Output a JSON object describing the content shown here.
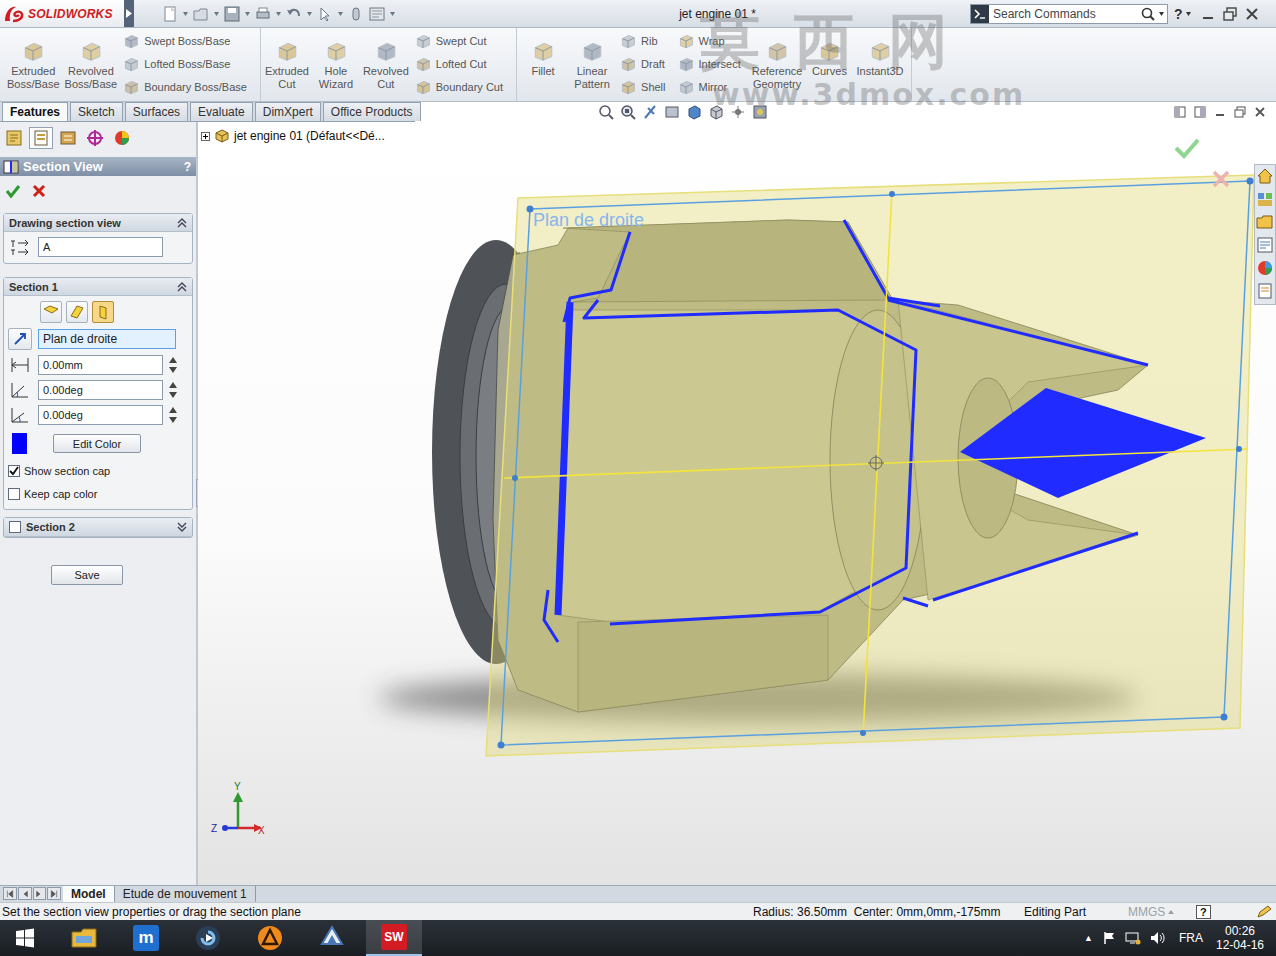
{
  "window": {
    "app": "SOLIDWORKS",
    "title": "jet engine 01 *",
    "search": {
      "placeholder": "Search Commands"
    },
    "help": "?"
  },
  "ribbon": {
    "groups": [
      {
        "items": [
          {
            "kind": "big",
            "label": "Extruded Boss/Base"
          },
          {
            "kind": "big",
            "label": "Revolved Boss/Base"
          },
          {
            "kind": "stack",
            "rows": [
              {
                "label": "Swept Boss/Base"
              },
              {
                "label": "Lofted Boss/Base"
              },
              {
                "label": "Boundary Boss/Base"
              }
            ]
          }
        ]
      },
      {
        "items": [
          {
            "kind": "big",
            "label": "Extruded Cut"
          },
          {
            "kind": "big",
            "label": "Hole Wizard"
          },
          {
            "kind": "big",
            "label": "Revolved Cut"
          },
          {
            "kind": "stack",
            "rows": [
              {
                "label": "Swept Cut"
              },
              {
                "label": "Lofted Cut"
              },
              {
                "label": "Boundary Cut"
              }
            ]
          }
        ]
      },
      {
        "items": [
          {
            "kind": "big",
            "label": "Fillet"
          },
          {
            "kind": "big",
            "label": "Linear Pattern"
          },
          {
            "kind": "stack",
            "rows": [
              {
                "label": "Rib"
              },
              {
                "label": "Draft"
              },
              {
                "label": "Shell"
              }
            ]
          },
          {
            "kind": "stack",
            "rows": [
              {
                "label": "Wrap"
              },
              {
                "label": "Intersect"
              },
              {
                "label": "Mirror"
              }
            ]
          },
          {
            "kind": "big",
            "label": "Reference Geometry"
          },
          {
            "kind": "big",
            "label": "Curves"
          },
          {
            "kind": "big",
            "label": "Instant3D"
          }
        ]
      }
    ]
  },
  "command_tabs": [
    {
      "label": "Features",
      "selected": true
    },
    {
      "label": "Sketch",
      "selected": false
    },
    {
      "label": "Surfaces",
      "selected": false
    },
    {
      "label": "Evaluate",
      "selected": false
    },
    {
      "label": "DimXpert",
      "selected": false
    },
    {
      "label": "Office Products",
      "selected": false
    }
  ],
  "manager_tabs": [
    {
      "kind": "feature-tree",
      "selected": false
    },
    {
      "kind": "property",
      "selected": true
    },
    {
      "kind": "configuration",
      "selected": false
    },
    {
      "kind": "dimxpert",
      "selected": false
    },
    {
      "kind": "display",
      "selected": false
    }
  ],
  "property_manager": {
    "title": "Section View",
    "help": "?",
    "drawing_section": {
      "title": "Drawing section view",
      "expanded": true,
      "name": "A"
    },
    "section1": {
      "title": "Section 1",
      "expanded": true,
      "planes": [
        {
          "selected": false
        },
        {
          "selected": false
        },
        {
          "selected": true
        }
      ],
      "reference": "Plan de droite",
      "distance": "0.00mm",
      "angle_x": "0.00deg",
      "angle_y": "0.00deg",
      "cap_color": "#0000ff",
      "edit_color": "Edit Color",
      "options": [
        {
          "label": "Show section cap",
          "checked": true
        },
        {
          "label": "Keep cap color",
          "checked": false
        }
      ]
    },
    "section2": {
      "title": "Section 2",
      "checked": false,
      "expanded": false
    },
    "save": "Save"
  },
  "feature_tree": {
    "label": "jet engine 01  (Défaut<<Dé...",
    "expanded": false
  },
  "viewport": {
    "plane_label": "Plan de droite",
    "triad": {
      "x": "X",
      "y": "Y",
      "z": "Z"
    }
  },
  "model_tabs": [
    {
      "label": "Model",
      "selected": true
    },
    {
      "label": "Etude de mouvement 1",
      "selected": false
    }
  ],
  "status_bar": {
    "message": "Set the section view properties or drag the section plane",
    "measure": "Radius: 36.50mm  Center: 0mm,0mm,-175mm",
    "mode": "Editing Part",
    "units": "MMGS",
    "help": "?"
  },
  "taskbar": {
    "apps": [
      {
        "kind": "explorer",
        "active": false
      },
      {
        "kind": "maxthon",
        "glyph": "m",
        "active": false
      },
      {
        "kind": "media",
        "active": false
      },
      {
        "kind": "avast",
        "active": false
      },
      {
        "kind": "edrawings",
        "active": false
      },
      {
        "kind": "solidworks",
        "glyph": "SW",
        "active": true
      }
    ],
    "tray": {
      "arrow": "▲",
      "language": "FRA",
      "time": "00:26",
      "date": "12-04-16"
    }
  },
  "watermark": {
    "title": "莫西网",
    "url": "www.3dmox.com"
  }
}
